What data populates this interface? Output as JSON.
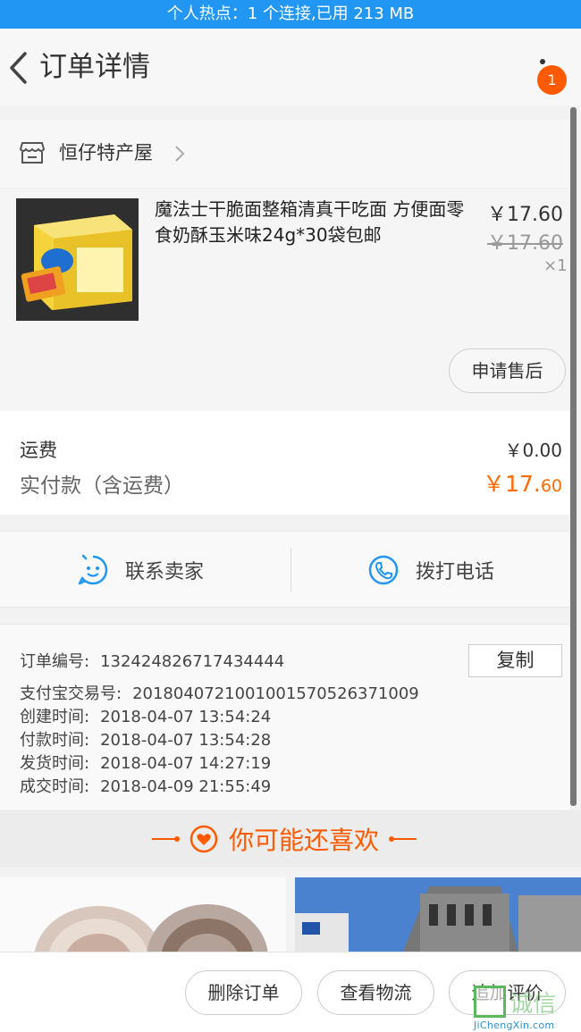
{
  "status_bar": {
    "text": "个人热点：1 个连接,已用 213 MB"
  },
  "nav": {
    "title": "订单详情",
    "badge_count": "1"
  },
  "shop": {
    "name": "恒仔特产屋"
  },
  "product": {
    "title": "魔法士干脆面整箱清真干吃面 方便面零食奶酥玉米味24g*30袋包邮",
    "price_now": "￥17.60",
    "price_old": "￥17.60",
    "quantity": "×1",
    "after_sale_label": "申请售后"
  },
  "fees": {
    "shipping_label": "运费",
    "shipping_value": "￥0.00",
    "paid_label": "实付款（含运费）",
    "paid_value_main": "￥17.",
    "paid_value_cents": "60"
  },
  "contact": {
    "seller_label": "联系卖家",
    "phone_label": "拨打电话"
  },
  "order_info": {
    "order_no_label": "订单编号:",
    "order_no": "132424826717434444",
    "copy_label": "复制",
    "alipay_label": "支付宝交易号:",
    "alipay_no": "2018040721001001570526371009",
    "created_label": "创建时间:",
    "created_time": "2018-04-07  13:54:24",
    "paid_label": "付款时间:",
    "paid_time": "2018-04-07  13:54:28",
    "shipped_label": "发货时间:",
    "shipped_time": "2018-04-07  14:27:19",
    "completed_label": "成交时间:",
    "completed_time": "2018-04-09  21:55:49"
  },
  "recommend": {
    "title": "你可能还喜欢"
  },
  "bottom_actions": {
    "delete_label": "删除订单",
    "logistics_label": "查看物流",
    "review_label": "追加评价"
  },
  "watermark": {
    "text": "诚信",
    "url": "JiChengXin.com"
  },
  "colors": {
    "accent": "#ff5a00",
    "status_bar": "#2196f3",
    "contact_icon": "#2196f3"
  }
}
